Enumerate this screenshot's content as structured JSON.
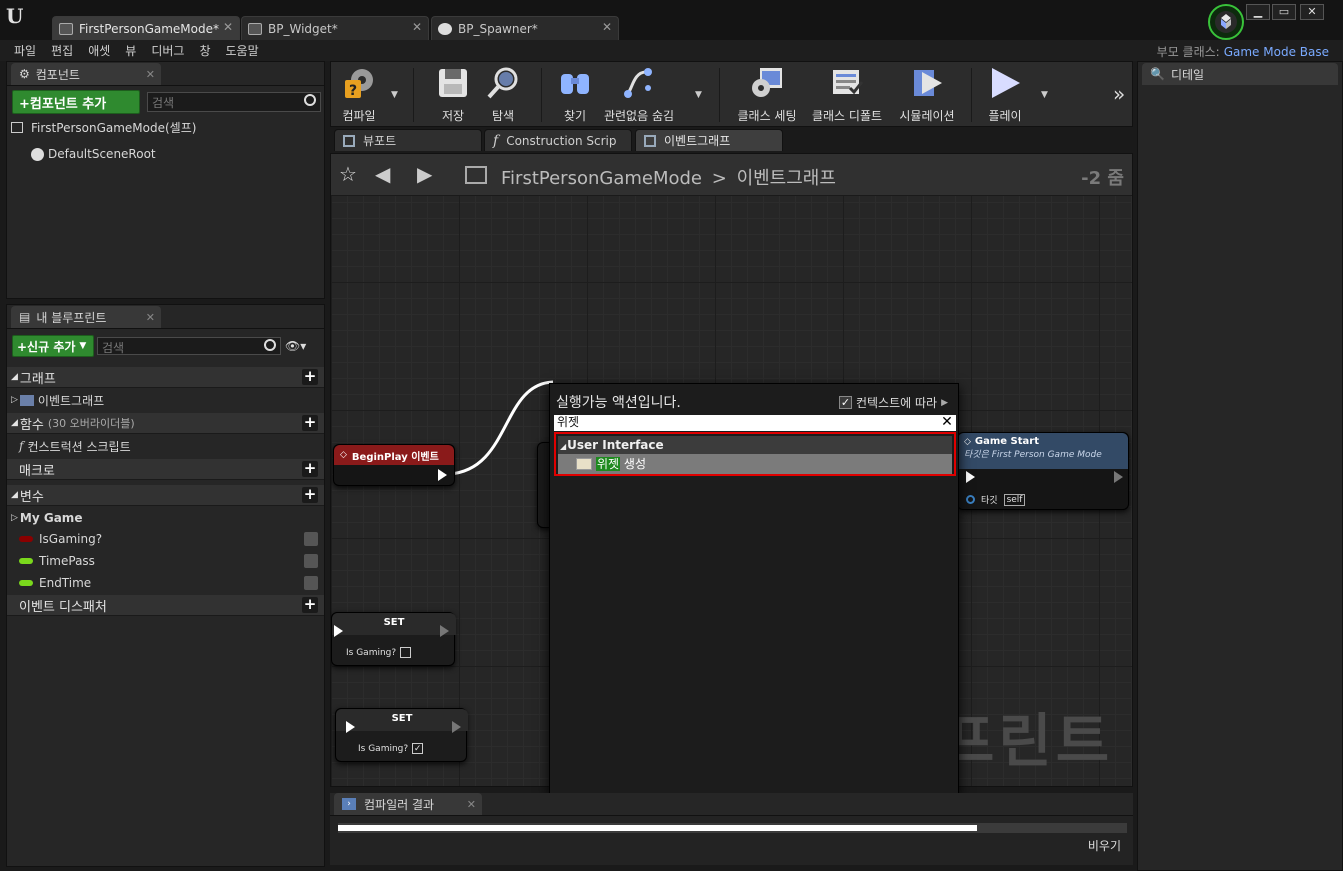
{
  "document_tabs": [
    {
      "label": "FirstPersonGameMode*",
      "active": true
    },
    {
      "label": "BP_Widget*",
      "active": false
    },
    {
      "label": "BP_Spawner*",
      "active": false
    }
  ],
  "menu": [
    "파일",
    "편집",
    "애셋",
    "뷰",
    "디버그",
    "창",
    "도움말"
  ],
  "parent_class": {
    "label": "부모 클래스:",
    "value": "Game Mode Base"
  },
  "components_panel": {
    "tab": "컴포넌트",
    "add_button": "+컴포넌트 추가",
    "search_placeholder": "검색",
    "root": "FirstPersonGameMode(셀프)",
    "child": "DefaultSceneRoot"
  },
  "my_blueprint": {
    "tab": "내 블루프린트",
    "add_button": "+신규 추가",
    "search_placeholder": "검색",
    "sections": {
      "graphs": "그래프",
      "event_graph": "이벤트그래프",
      "functions": "함수",
      "functions_note": "(30 오버라이더블)",
      "construction_script": "컨스트럭션 스크립트",
      "macros": "매크로",
      "variables": "변수",
      "my_game": "My Game",
      "event_dispatchers": "이벤트 디스패처"
    },
    "variables": [
      {
        "name": "IsGaming?",
        "color": "#8a0000"
      },
      {
        "name": "TimePass",
        "color": "#7ad81c"
      },
      {
        "name": "EndTime",
        "color": "#7ad81c"
      }
    ]
  },
  "toolbar": {
    "compile": "컴파일",
    "save": "저장",
    "browse": "탐색",
    "find": "찾기",
    "hide_unrelated": "관련없음 숨김",
    "class_settings": "클래스 세팅",
    "class_defaults": "클래스 디폴트",
    "simulation": "시뮬레이션",
    "play": "플레이"
  },
  "editor_tabs": [
    {
      "label": "뷰포트",
      "active": false
    },
    {
      "label": "Construction Scrip",
      "active": false
    },
    {
      "label": "이벤트그래프",
      "active": true
    }
  ],
  "graph": {
    "breadcrumb_root": "FirstPersonGameMode",
    "breadcrumb_sep": ">",
    "breadcrumb_current": "이벤트그래프",
    "zoom": "-2 줌",
    "watermark": "프린트",
    "nodes": {
      "begin_play": "BeginPlay 이벤트",
      "game_start_title": "Game Start",
      "game_start_sub": "타깃은 First Person Game Mode",
      "target_label": "타깃",
      "self_label": "self",
      "set1_title": "SET",
      "set1_var": "Is Gaming?",
      "set2_title": "SET",
      "set2_var": "Is Gaming?"
    }
  },
  "action_menu": {
    "title": "실행가능 액션입니다.",
    "context_label": "컨텍스트에 따라",
    "context_checked": true,
    "search_value": "위젯",
    "category": "User Interface",
    "item_highlight": "위젯",
    "item_rest": " 생성"
  },
  "details_panel": {
    "tab": "디테일"
  },
  "compiler_results": {
    "tab": "컴파일러 결과",
    "progress": 0.81,
    "clear": "비우기"
  }
}
